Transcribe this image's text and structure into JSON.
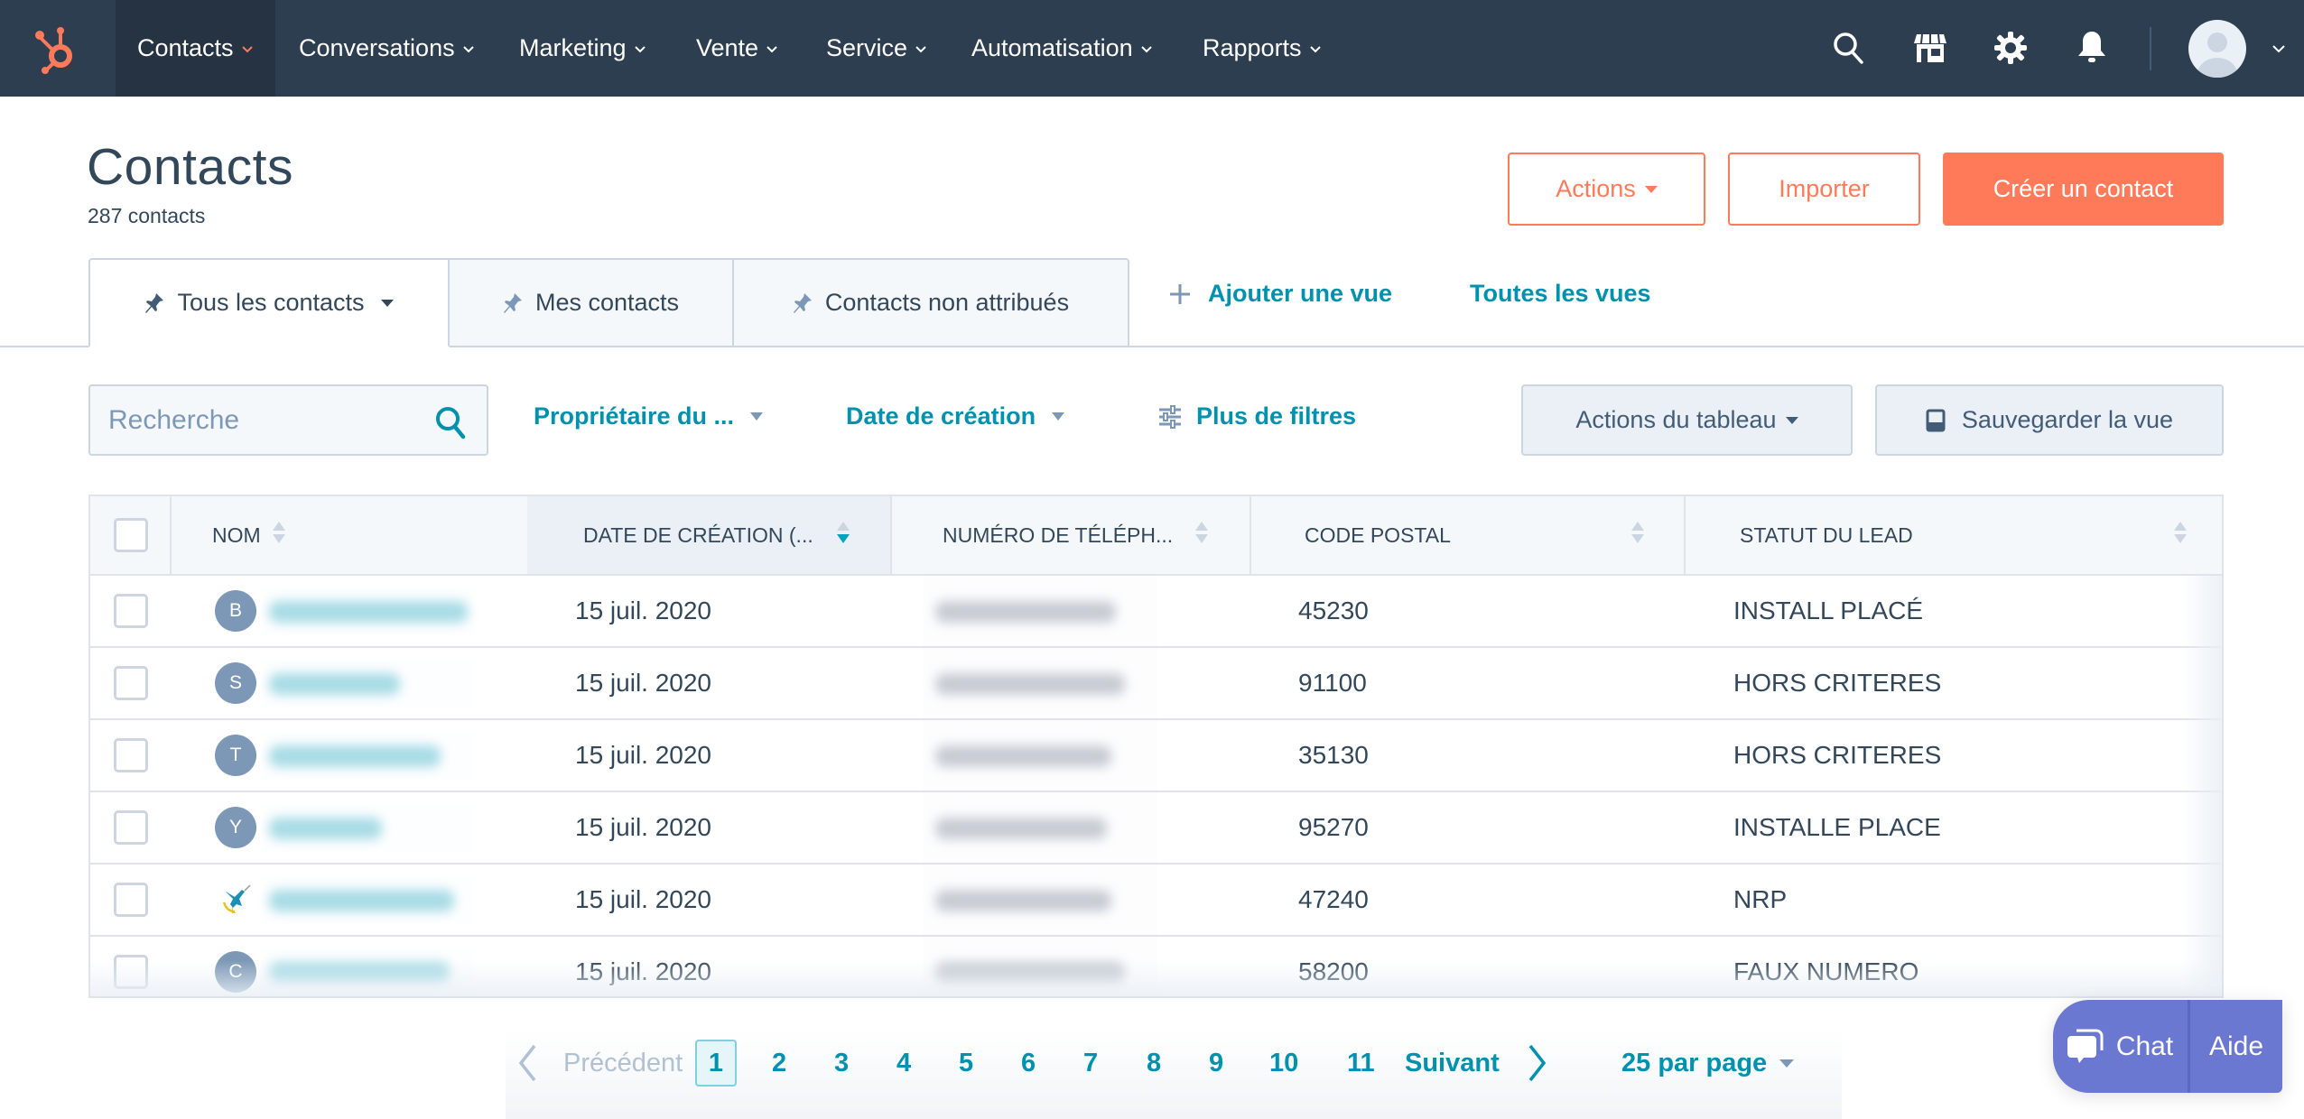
{
  "colors": {
    "nav_bg": "#2d3e50",
    "brand_orange": "#ff7a59",
    "link_teal": "#0091ae",
    "chat_purple": "#6a78d1",
    "avatar_gray": "#7c98b6"
  },
  "nav": {
    "logo": "hubspot-sprocket-icon",
    "items": [
      {
        "label": "Contacts",
        "active": true
      },
      {
        "label": "Conversations"
      },
      {
        "label": "Marketing"
      },
      {
        "label": "Vente"
      },
      {
        "label": "Service"
      },
      {
        "label": "Automatisation"
      },
      {
        "label": "Rapports"
      }
    ],
    "icons": [
      "search-icon",
      "marketplace-icon",
      "settings-gear-icon",
      "notifications-bell-icon"
    ],
    "account_menu": "avatar"
  },
  "header": {
    "title": "Contacts",
    "count": "287 contacts",
    "actions_label": "Actions",
    "import_label": "Importer",
    "create_label": "Créer un contact"
  },
  "tabs": {
    "views": [
      {
        "label": "Tous les contacts",
        "active": true
      },
      {
        "label": "Mes contacts"
      },
      {
        "label": "Contacts non attribués"
      }
    ],
    "add_view": "Ajouter une vue",
    "all_views": "Toutes les vues"
  },
  "filters": {
    "search_placeholder": "Recherche",
    "owner": "Propriétaire du ...",
    "created_date": "Date de création",
    "more_filters": "Plus de filtres",
    "table_actions": "Actions du tableau",
    "save_view": "Sauvegarder la vue"
  },
  "table": {
    "columns": [
      "NOM",
      "DATE DE CRÉATION (...",
      "NUMÉRO DE TÉLÉPH...",
      "CODE POSTAL",
      "STATUT DU LEAD"
    ],
    "sorted_column": "DATE DE CRÉATION (...",
    "sort_direction": "descending",
    "rows": [
      {
        "initial": "B",
        "name": "(masqué)",
        "created": "15 juil. 2020",
        "phone": "(masqué)",
        "postal": "45230",
        "status": "INSTALL PLACÉ"
      },
      {
        "initial": "S",
        "name": "(masqué)",
        "created": "15 juil. 2020",
        "phone": "(masqué)",
        "postal": "91100",
        "status": "HORS CRITERES"
      },
      {
        "initial": "T",
        "name": "(masqué)",
        "created": "15 juil. 2020",
        "phone": "(masqué)",
        "postal": "35130",
        "status": "HORS CRITERES"
      },
      {
        "initial": "Y",
        "name": "(masqué)",
        "created": "15 juil. 2020",
        "phone": "(masqué)",
        "postal": "95270",
        "status": "INSTALLE PLACE"
      },
      {
        "initial": "",
        "avatar_icon": "company-logo-hummingbird",
        "name": "(masqué)",
        "created": "15 juil. 2020",
        "phone": "(masqué)",
        "postal": "47240",
        "status": "NRP"
      },
      {
        "initial": "C",
        "name": "(masqué)",
        "created": "15 juil. 2020",
        "phone": "(masqué)",
        "postal": "58200",
        "status": "FAUX NUMERO"
      }
    ]
  },
  "pagination": {
    "prev": "Précédent",
    "next": "Suivant",
    "pages": [
      "1",
      "2",
      "3",
      "4",
      "5",
      "6",
      "7",
      "8",
      "9",
      "10",
      "11"
    ],
    "current": "1",
    "per_page": "25 par page"
  },
  "chat_widget": {
    "chat": "Chat",
    "help": "Aide"
  }
}
